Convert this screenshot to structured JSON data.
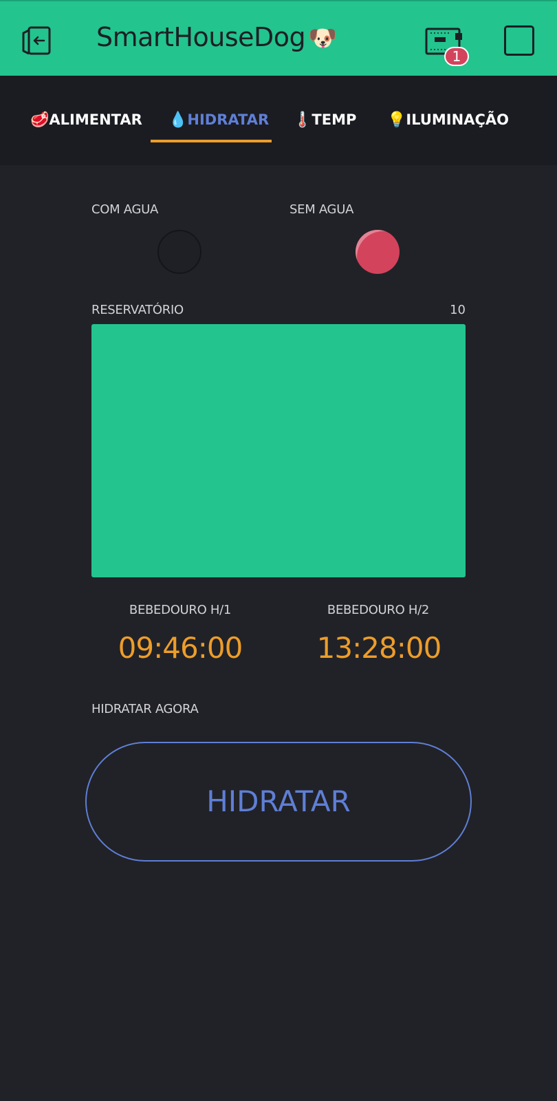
{
  "header": {
    "title": "SmartHouseDog",
    "title_emoji": "🐶",
    "notification_count": "1",
    "icons": [
      "exit-icon",
      "device-icon",
      "square-icon"
    ]
  },
  "tabs": [
    {
      "emoji": "🥩",
      "label": "ALIMENTAR",
      "active": false
    },
    {
      "emoji": "💧",
      "label": "HIDRATAR",
      "active": true
    },
    {
      "emoji": "🌡️",
      "label": "TEMP",
      "active": false
    },
    {
      "emoji": "💡",
      "label": "ILUMINAÇÃO",
      "active": false
    }
  ],
  "leds": {
    "com_agua": {
      "label": "COM AGUA",
      "state": "off"
    },
    "sem_agua": {
      "label": "SEM AGUA",
      "state": "on"
    }
  },
  "reservoir": {
    "label": "RESERVATÓRIO",
    "value": "10",
    "fill_fraction": 1.0
  },
  "schedules": {
    "h1": {
      "label": "BEBEDOURO H/1",
      "time": "09:46:00"
    },
    "h2": {
      "label": "BEBEDOURO H/2",
      "time": "13:28:00"
    }
  },
  "action": {
    "label": "HIDRATAR AGORA",
    "button_label": "HIDRATAR"
  },
  "colors": {
    "accent_green": "#23c48e",
    "accent_blue": "#5f7fd6",
    "accent_orange": "#ed9d2a",
    "led_red": "#d3435c",
    "background": "#212227"
  }
}
